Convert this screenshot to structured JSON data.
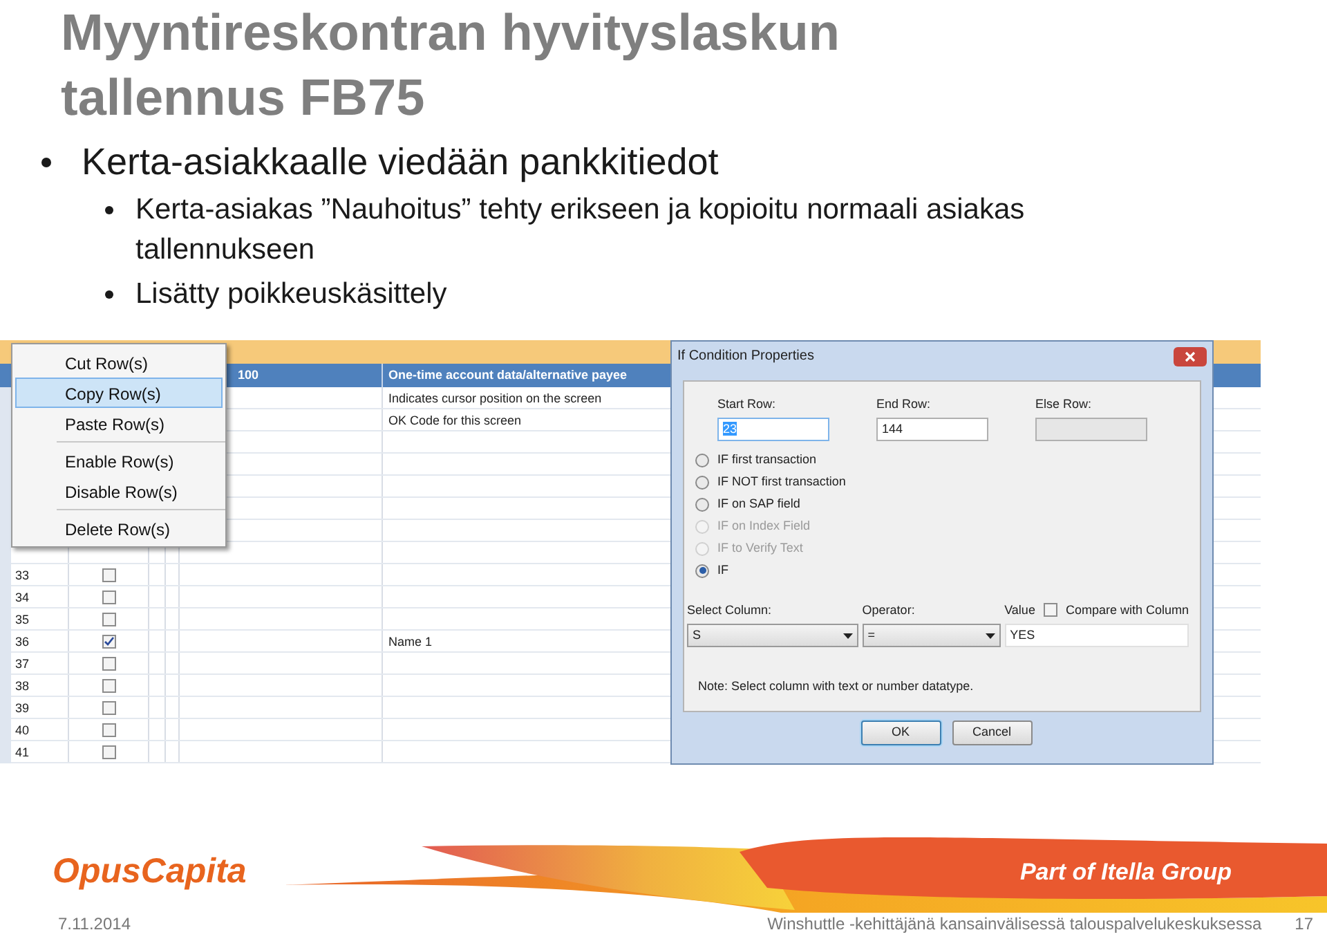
{
  "slide": {
    "title_lines": [
      "Myyntireskontran hyvityslaskun",
      "tallennus FB75"
    ],
    "bullets": [
      {
        "text": "Kerta-asiakkaalle viedään pankkitiedot",
        "children": [
          {
            "text": "Kerta-asiakas ”Nauhoitus” tehty erikseen ja kopioitu normaali asiakas tallennukseen"
          },
          {
            "text": "Lisätty poikkeuskäsittely"
          }
        ]
      }
    ]
  },
  "grid": {
    "header": {
      "column_5": "100",
      "column_6": "One-time account data/alternative payee"
    },
    "rows": [
      {
        "description": "Indicates cursor position on the screen"
      },
      {
        "description": "OK Code for this screen"
      },
      {},
      {},
      {},
      {},
      {},
      {},
      {
        "number": "33",
        "checked": false
      },
      {
        "number": "34",
        "checked": false
      },
      {
        "number": "35",
        "checked": false
      },
      {
        "number": "36",
        "checked": true,
        "description": "Name 1"
      },
      {
        "number": "37",
        "checked": false
      },
      {
        "number": "38",
        "checked": false
      },
      {
        "number": "39",
        "checked": false
      },
      {
        "number": "40",
        "checked": false
      },
      {
        "number": "41",
        "checked": false
      }
    ]
  },
  "context_menu": {
    "groups": [
      [
        {
          "label": "Cut Row(s)",
          "selected": false
        },
        {
          "label": "Copy Row(s)",
          "selected": true
        },
        {
          "label": "Paste Row(s)",
          "selected": false
        }
      ],
      [
        {
          "label": "Enable Row(s)",
          "selected": false
        },
        {
          "label": "Disable Row(s)",
          "selected": false
        }
      ],
      [
        {
          "label": "Delete Row(s)",
          "selected": false
        }
      ]
    ]
  },
  "dialog": {
    "title": "If Condition Properties",
    "fields": [
      {
        "label": "Start Row:",
        "value": "23",
        "disabled": false,
        "highlighted": true
      },
      {
        "label": "End Row:",
        "value": "144",
        "disabled": false,
        "highlighted": false
      },
      {
        "label": "Else Row:",
        "disabled": true,
        "highlighted": false
      }
    ],
    "options": [
      {
        "label": "IF first transaction",
        "selected": false,
        "disabled": false
      },
      {
        "label": "IF NOT first transaction",
        "selected": false,
        "disabled": false
      },
      {
        "label": "IF on SAP field",
        "selected": false,
        "disabled": false
      },
      {
        "label": "IF on Index Field",
        "selected": false,
        "disabled": true
      },
      {
        "label": "IF to Verify Text",
        "selected": false,
        "disabled": true
      },
      {
        "label": "IF",
        "selected": true,
        "disabled": false
      }
    ],
    "select_column": {
      "label": "Select Column:",
      "value": "S"
    },
    "operator": {
      "label": "Operator:",
      "value": "="
    },
    "value": {
      "label": "Value",
      "value": "YES"
    },
    "compare_with_column": {
      "label": "Compare with Column",
      "checked": false
    },
    "note": "Note: Select column with text or number datatype.",
    "buttons": [
      {
        "label": "OK",
        "default": true
      },
      {
        "label": "Cancel",
        "default": false
      }
    ]
  },
  "footer": {
    "logo": "OpusCapita",
    "tagline": "Part of Itella Group",
    "date": "7.11.2014",
    "caption": "Winshuttle -kehittäjänä kansainvälisessä talouspalvelukeskuksessa",
    "page": "17"
  }
}
